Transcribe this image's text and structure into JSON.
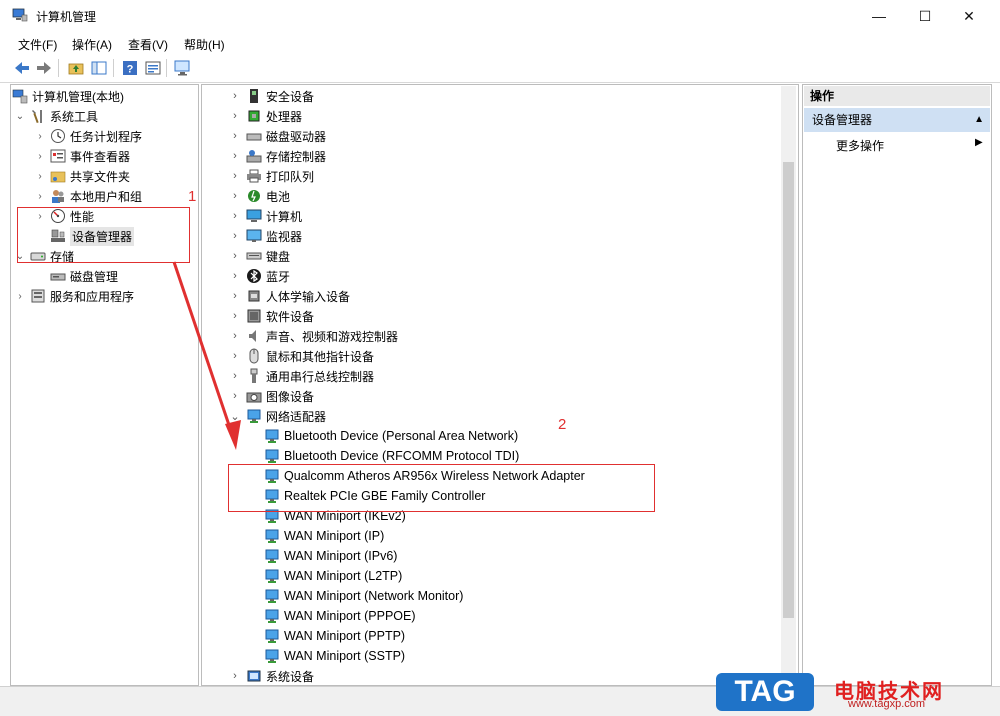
{
  "window": {
    "title": "计算机管理",
    "controls": {
      "minimize": "—",
      "maximize": "☐",
      "close": "✕"
    }
  },
  "menu": [
    "文件(F)",
    "操作(A)",
    "查看(V)",
    "帮助(H)"
  ],
  "toolbar_icons": [
    "back-arrow-icon",
    "forward-arrow-icon",
    "up-folder-icon",
    "show-hide-tree-icon",
    "help-icon",
    "properties-icon",
    "monitor-icon"
  ],
  "tree": {
    "root": "计算机管理(本地)",
    "system_tools": "系统工具",
    "task_scheduler": "任务计划程序",
    "event_viewer": "事件查看器",
    "shared_folders": "共享文件夹",
    "local_users": "本地用户和组",
    "performance": "性能",
    "device_manager": "设备管理器",
    "storage": "存储",
    "disk_management": "磁盘管理",
    "services": "服务和应用程序"
  },
  "devices": {
    "categories_top": [
      "安全设备",
      "处理器",
      "磁盘驱动器",
      "存储控制器",
      "打印队列",
      "电池",
      "计算机",
      "监视器",
      "键盘",
      "蓝牙",
      "人体学输入设备",
      "软件设备",
      "声音、视频和游戏控制器",
      "鼠标和其他指针设备",
      "通用串行总线控制器",
      "图像设备"
    ],
    "network_category": "网络适配器",
    "network_adapters": [
      "Bluetooth Device (Personal Area Network)",
      "Bluetooth Device (RFCOMM Protocol TDI)",
      "Qualcomm Atheros AR956x Wireless Network Adapter",
      "Realtek PCIe GBE Family Controller",
      "WAN Miniport (IKEv2)",
      "WAN Miniport (IP)",
      "WAN Miniport (IPv6)",
      "WAN Miniport (L2TP)",
      "WAN Miniport (Network Monitor)",
      "WAN Miniport (PPPOE)",
      "WAN Miniport (PPTP)",
      "WAN Miniport (SSTP)"
    ],
    "last_category": "系统设备"
  },
  "actions": {
    "header": "操作",
    "selected": "设备管理器",
    "more": "更多操作"
  },
  "annotations": {
    "one": "1",
    "two": "2"
  },
  "watermark": {
    "tag": "TAG",
    "cn": "电脑技术网",
    "url": "www.tagxp.com"
  },
  "colors": {
    "annotation_red": "#e03030",
    "selection_blue": "#cfe0f3"
  }
}
